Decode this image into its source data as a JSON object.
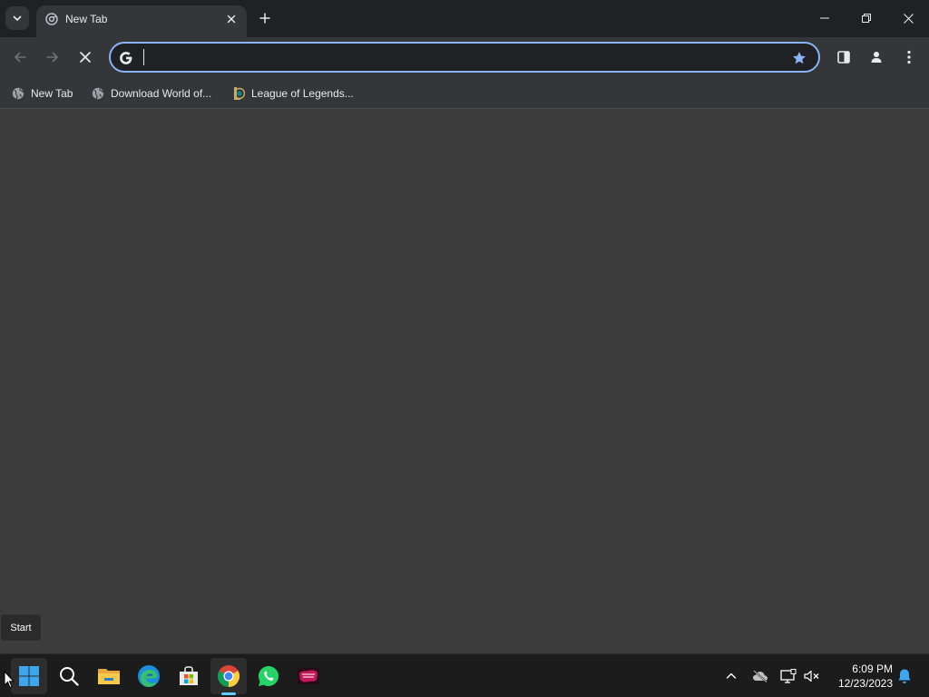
{
  "tabstrip": {
    "tab_title": "New Tab",
    "tab_icon": "chrome-newtab-icon",
    "new_tab_icon": "plus-icon"
  },
  "window_controls": {
    "minimize_icon": "minimize-icon",
    "restore_icon": "restore-icon",
    "close_icon": "close-icon"
  },
  "toolbar": {
    "back_icon": "arrow-left-icon",
    "forward_icon": "arrow-right-icon",
    "stop_icon": "close-icon",
    "omnibox": {
      "value": "",
      "placeholder": "",
      "search_engine_icon": "google-g-icon",
      "bookmark_icon": "star-filled-icon"
    },
    "side_panel_icon": "side-panel-icon",
    "profile_icon": "person-icon",
    "menu_icon": "kebab-menu-icon"
  },
  "bookmarks": [
    {
      "label": "New Tab",
      "icon": "globe-icon"
    },
    {
      "label": "Download World of...",
      "icon": "globe-icon"
    },
    {
      "label": "League of Legends...",
      "icon": "league-of-legends-icon"
    }
  ],
  "tooltip": {
    "text": "Start"
  },
  "taskbar": {
    "apps": [
      "start",
      "search",
      "file-explorer",
      "edge",
      "microsoft-store",
      "chrome",
      "whatsapp",
      "game"
    ],
    "clock": {
      "time": "6:09 PM",
      "date": "12/23/2023"
    }
  },
  "colors": {
    "accent": "#8ab4f8",
    "tabstrip_bg": "#202124",
    "toolbar_bg": "#35363a",
    "page_bg": "#3c3c3c",
    "taskbar_bg": "#1c1c1c",
    "taskbar_active": "#60cdff"
  }
}
